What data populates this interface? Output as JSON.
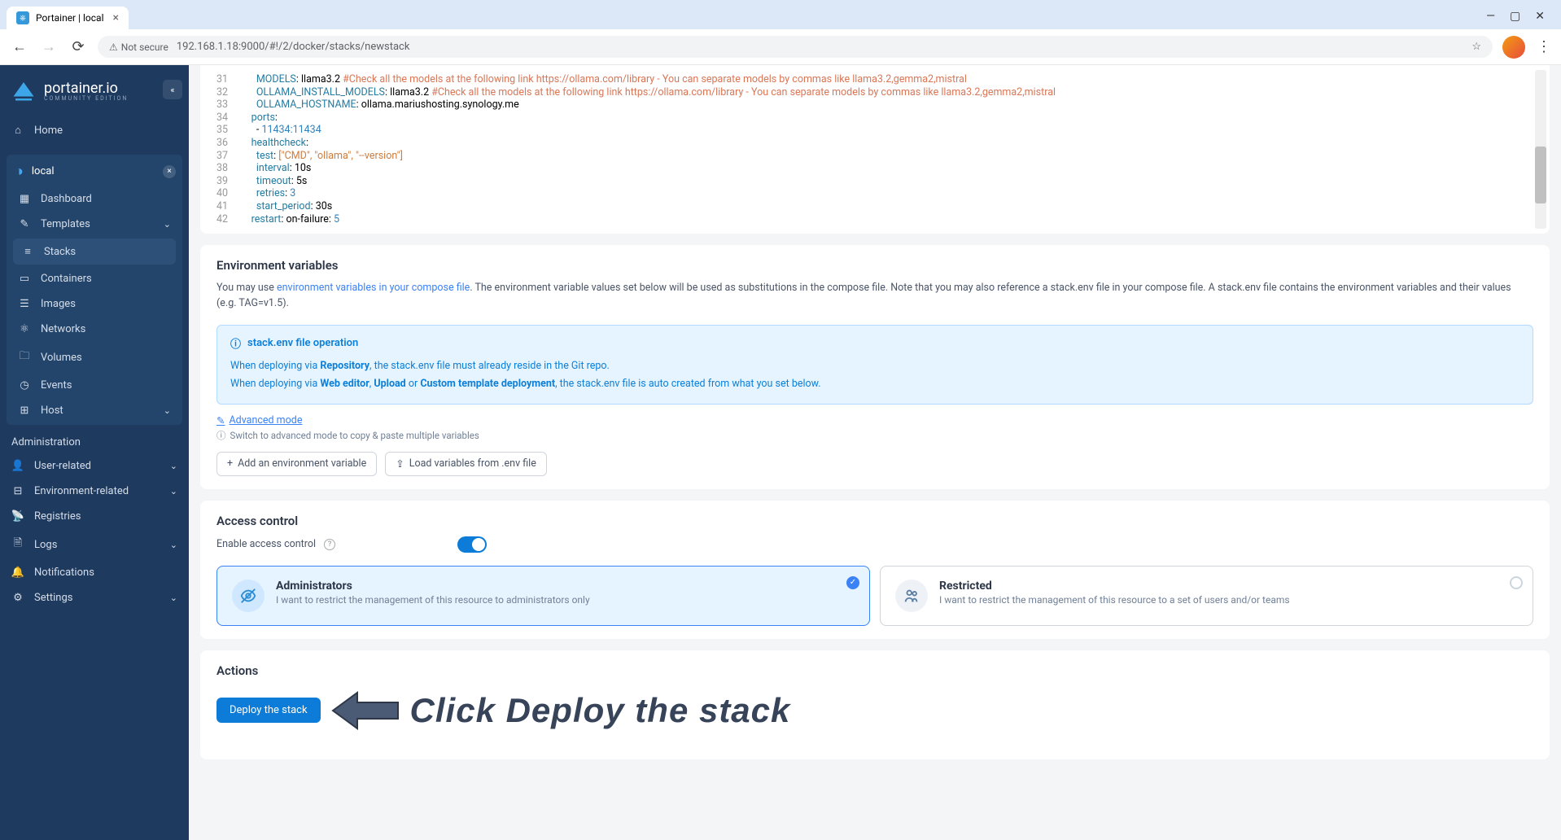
{
  "browser": {
    "tab_title": "Portainer | local",
    "url": "192.168.1.18:9000/#!/2/docker/stacks/newstack",
    "not_secure": "Not secure"
  },
  "sidebar": {
    "brand": "portainer.io",
    "brand_sub": "COMMUNITY EDITION",
    "home": "Home",
    "env": "local",
    "items": [
      "Dashboard",
      "Templates",
      "Stacks",
      "Containers",
      "Images",
      "Networks",
      "Volumes",
      "Events",
      "Host"
    ],
    "admin_label": "Administration",
    "admin_items": [
      "User-related",
      "Environment-related",
      "Registries",
      "Logs",
      "Notifications",
      "Settings"
    ]
  },
  "code": {
    "lines": [
      {
        "n": 31,
        "indent": "        ",
        "key": "MODELS",
        "val": "llama3.2",
        "cmt": "#Check all the models at the following link https://ollama.com/library - You can separate models by commas like llama3.2,gemma2,mistral"
      },
      {
        "n": 32,
        "indent": "        ",
        "key": "OLLAMA_INSTALL_MODELS",
        "val": "llama3.2",
        "cmt": "#Check all the models at the following link https://ollama.com/library - You can separate models by commas like llama3.2,gemma2,mistral"
      },
      {
        "n": 33,
        "indent": "        ",
        "key": "OLLAMA_HOSTNAME",
        "val": "ollama.mariushosting.synology.me",
        "cmt": ""
      },
      {
        "n": 34,
        "indent": "      ",
        "key": "ports",
        "val": "",
        "cmt": ""
      },
      {
        "n": 35,
        "indent": "        - ",
        "num": "11434:11434"
      },
      {
        "n": 36,
        "indent": "      ",
        "key": "healthcheck",
        "val": "",
        "cmt": ""
      },
      {
        "n": 37,
        "indent": "        ",
        "key": "test",
        "arr": "[\"CMD\", \"ollama\", \"--version\"]"
      },
      {
        "n": 38,
        "indent": "        ",
        "key": "interval",
        "val": "10s"
      },
      {
        "n": 39,
        "indent": "        ",
        "key": "timeout",
        "val": "5s"
      },
      {
        "n": 40,
        "indent": "        ",
        "key": "retries",
        "num": "3"
      },
      {
        "n": 41,
        "indent": "        ",
        "key": "start_period",
        "val": "30s"
      },
      {
        "n": 42,
        "indent": "      ",
        "key": "restart",
        "val": "on-failure:",
        "num": "5"
      }
    ]
  },
  "env": {
    "title": "Environment variables",
    "desc_prefix": "You may use ",
    "desc_link": "environment variables in your compose file",
    "desc_suffix": ". The environment variable values set below will be used as substitutions in the compose file. Note that you may also reference a stack.env file in your compose file. A stack.env file contains the environment variables and their values (e.g. TAG=v1.5).",
    "info_title": "stack.env file operation",
    "info_line1_a": "When deploying via ",
    "info_line1_b": "Repository",
    "info_line1_c": ", the stack.env file must already reside in the Git repo.",
    "info_line2_a": "When deploying via ",
    "info_line2_b": "Web editor",
    "info_line2_c": ", ",
    "info_line2_d": "Upload",
    "info_line2_e": " or ",
    "info_line2_f": "Custom template deployment",
    "info_line2_g": ", the stack.env file is auto created from what you set below.",
    "advanced": "Advanced mode",
    "advanced_hint": "Switch to advanced mode to copy & paste multiple variables",
    "btn_add": "Add an environment variable",
    "btn_load": "Load variables from .env file"
  },
  "access": {
    "title": "Access control",
    "enable_label": "Enable access control",
    "admin_title": "Administrators",
    "admin_desc": "I want to restrict the management of this resource to administrators only",
    "restricted_title": "Restricted",
    "restricted_desc": "I want to restrict the management of this resource to a set of users and/or teams"
  },
  "actions": {
    "title": "Actions",
    "deploy": "Deploy the stack"
  },
  "annotation": "Click Deploy the stack"
}
